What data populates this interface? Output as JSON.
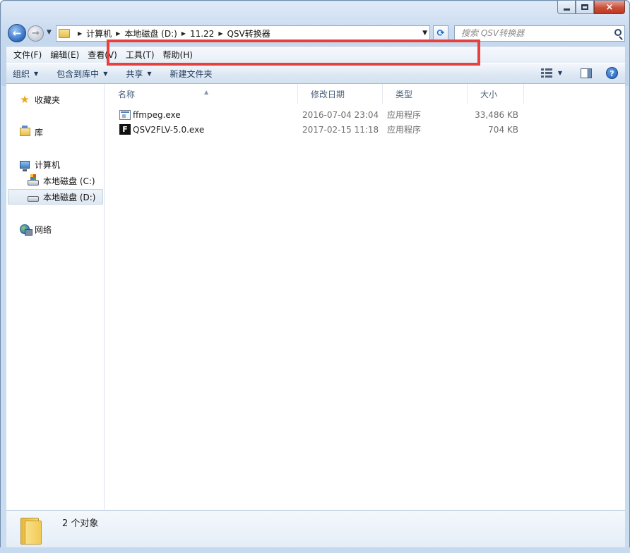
{
  "window": {
    "caption_close": "×"
  },
  "nav": {
    "back_glyph": "←",
    "forward_glyph": "→",
    "breadcrumb": [
      "计算机",
      "本地磁盘 (D:)",
      "11.22",
      "QSV转换器"
    ],
    "search_placeholder": "搜索 QSV转换器",
    "refresh_glyph": "⟳"
  },
  "menu": [
    "文件(F)",
    "编辑(E)",
    "查看(V)",
    "工具(T)",
    "帮助(H)"
  ],
  "toolbar": {
    "organize": "组织",
    "include_in_library": "包含到库中",
    "share": "共享",
    "new_folder": "新建文件夹",
    "help_glyph": "?"
  },
  "sidebar": {
    "favorites": "收藏夹",
    "libraries": "库",
    "computer": "计算机",
    "drive_c": "本地磁盘 (C:)",
    "drive_d": "本地磁盘 (D:)",
    "network": "网络"
  },
  "columns": {
    "name": "名称",
    "modified": "修改日期",
    "type": "类型",
    "size": "大小"
  },
  "files": [
    {
      "name": "ffmpeg.exe",
      "modified": "2016-07-04 23:04",
      "type": "应用程序",
      "size": "33,486 KB",
      "icon": "exe-icon"
    },
    {
      "name": "QSV2FLV-5.0.exe",
      "modified": "2017-02-15 11:18",
      "type": "应用程序",
      "size": "704 KB",
      "icon": "app-f-icon",
      "icon_letter": "F",
      "highlighted": true
    }
  ],
  "details": {
    "item_count": "2 个对象"
  },
  "colors": {
    "highlight_border": "#e8413d",
    "frame": "#c9dcf0",
    "toolbar_text": "#1e395b"
  }
}
